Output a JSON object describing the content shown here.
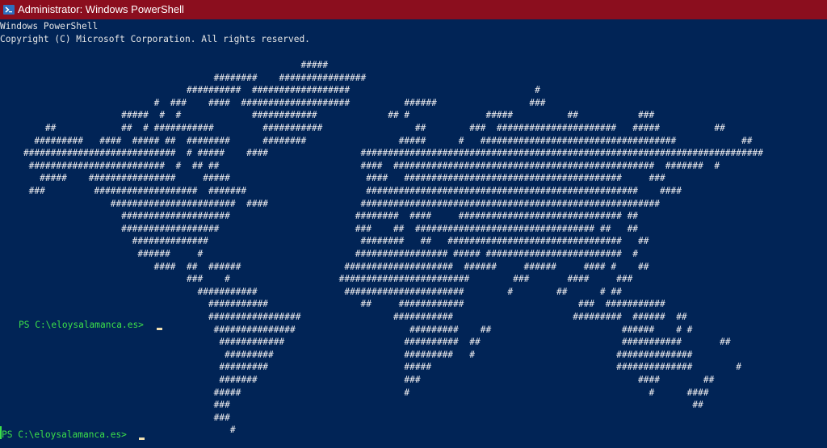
{
  "window": {
    "title": "Administrator: Windows PowerShell",
    "icon": "powershell-icon",
    "titlebar_color": "#8B0E1E",
    "background_color": "#012456"
  },
  "console": {
    "header_lines": [
      "Windows PowerShell",
      "Copyright (C) Microsoft Corporation. All rights reserved."
    ],
    "ascii_map": [
      "                                                       #####",
      "                                       ########    ################",
      "                                  ##########  ##################                                  #",
      "                            #  ###    ####  ####################          ######                 ###",
      "                      #####  #  #             ############             ## #              #####          ##           ###",
      "        ##            ##  # ###########         ###########                 ##        ###  ######################   #####          ##",
      "      #########   ####  ##### ##  ########      ########                 #####      #   ####################################            ##",
      "    ############################  # #####    ####                 ##########################################################################",
      "     #########################  #  ## ##                          ####  ################################################  #######  #",
      "       #####    ################     #####                         ####   ########################################     ###",
      "     ###         ###################  #######                      ##################################################    ####",
      "                    #######################  ####                 #######################################################",
      "                      ####################                       ########  ####     ############################## ##",
      "                      ##################                         ###    ##  ################################# ##   ##",
      "                        ##############                            ########   ##   ################################   ##",
      "                         ######     #                            ################# ##### #########################  #",
      "                            ####  ##  ######                   ####################  ######     ######     #### #    ##",
      "                                  ###    #                    ########################        ###       ####     ###",
      "                                    ###########                ######################        #        ##      # ##",
      "                                      ###########                 ##     ############                     ###  ###########",
      "                                      #################                 ###########                      #########  ######  ##",
      "                                       ###############                     #########    ##                        ######    # #",
      "                                        ############                      ##########  ##                          ###########       ##",
      "                                         #########                        #########   #                          ##############",
      "                                        #########                         #####                                  ##############        #",
      "                                        #######                           ###                                        ####        ##",
      "                                       #####                              #                                            #      ####",
      "                                       ###                                                                                     ##",
      "                                       ###",
      "                                          #"
    ],
    "prompts": [
      "PS C:\\eloysalamanca.es> ",
      "PS C:\\eloysalamanca.es> "
    ],
    "text_color": "#eeedf0",
    "prompt_color": "#3ce049"
  }
}
